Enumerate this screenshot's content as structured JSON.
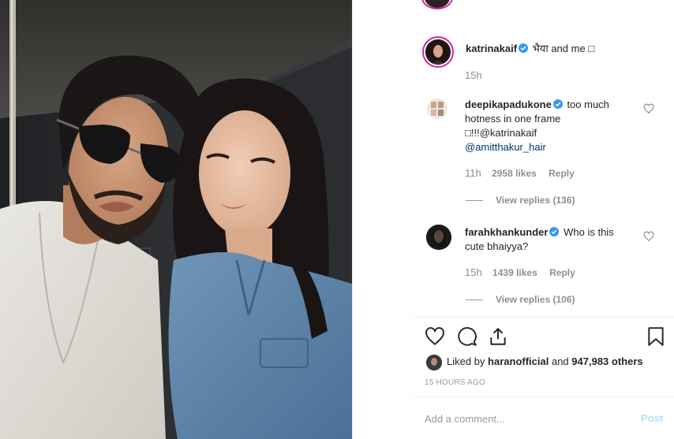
{
  "post": {
    "author": "katrinakaif",
    "caption": "भैया and me □",
    "time": "15h"
  },
  "comments": [
    {
      "user": "deepikapadukone",
      "text": "too much hotness in one frame",
      "line3": "□!!!@katrinakaif",
      "line4": "@amitthakur_hair",
      "time": "11h",
      "likes": "2958 likes",
      "reply": "Reply",
      "view_replies": "View replies (136)"
    },
    {
      "user": "farahkhankunder",
      "text": "Who is this cute bhaiyya?",
      "time": "15h",
      "likes": "1439 likes",
      "reply": "Reply",
      "view_replies": "View replies (106)"
    }
  ],
  "likes_summary": {
    "prefix": "Liked by",
    "user": "haranofficial",
    "middle": "and",
    "others": "947,983 others"
  },
  "timestamp": "15 HOURS AGO",
  "add_comment": {
    "placeholder": "Add a comment...",
    "post_label": "Post"
  },
  "icons": [
    "heart-icon",
    "comment-icon",
    "share-icon",
    "bookmark-icon",
    "verified-badge-icon"
  ],
  "colors": {
    "verified": "#3897f0",
    "text": "#262626",
    "muted": "#8e8e8e",
    "post_disabled": "#b2dffc",
    "story_ring": "#d6249f"
  }
}
